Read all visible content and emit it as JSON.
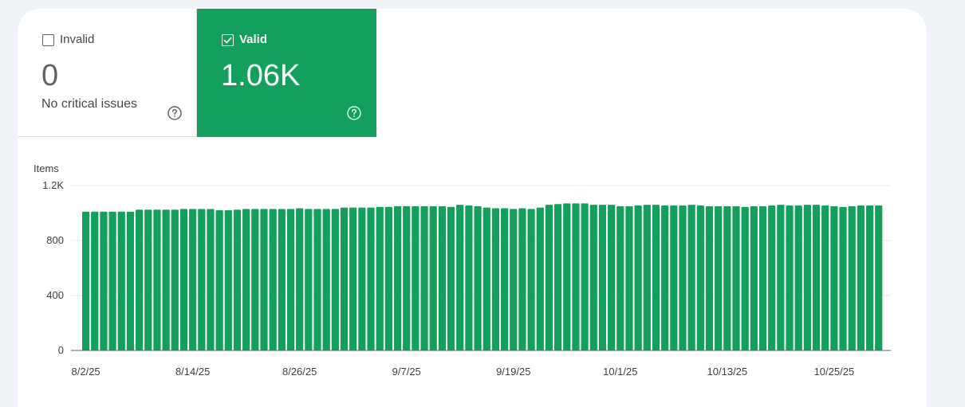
{
  "tabs": {
    "invalid": {
      "label": "Invalid",
      "value": "0",
      "subtitle": "No critical issues",
      "checked": false
    },
    "valid": {
      "label": "Valid",
      "value": "1.06K",
      "checked": true
    }
  },
  "colors": {
    "valid_green": "#12a05c",
    "bar_green": "#12a05c",
    "grid": "#e8eaed",
    "text": "#3c4043"
  },
  "icons": {
    "help": "help-circle-icon",
    "checkbox": "checkbox-icon"
  },
  "chart_data": {
    "type": "bar",
    "ylabel": "Items",
    "ylim": [
      0,
      1200
    ],
    "yticks": [
      {
        "value": 0,
        "label": "0"
      },
      {
        "value": 400,
        "label": "400"
      },
      {
        "value": 800,
        "label": "800"
      },
      {
        "value": 1200,
        "label": "1.2K"
      }
    ],
    "x_tick_labels": [
      {
        "index": 0,
        "label": "8/2/25"
      },
      {
        "index": 12,
        "label": "8/14/25"
      },
      {
        "index": 24,
        "label": "8/26/25"
      },
      {
        "index": 36,
        "label": "9/7/25"
      },
      {
        "index": 48,
        "label": "9/19/25"
      },
      {
        "index": 60,
        "label": "10/1/25"
      },
      {
        "index": 72,
        "label": "10/13/25"
      },
      {
        "index": 84,
        "label": "10/25/25"
      }
    ],
    "grid": true,
    "series": [
      {
        "values": [
          1010,
          1010,
          1010,
          1010,
          1010,
          1010,
          1025,
          1025,
          1025,
          1025,
          1025,
          1030,
          1030,
          1030,
          1030,
          1020,
          1020,
          1025,
          1030,
          1030,
          1030,
          1030,
          1030,
          1030,
          1035,
          1030,
          1030,
          1030,
          1030,
          1040,
          1040,
          1040,
          1040,
          1045,
          1045,
          1050,
          1050,
          1050,
          1050,
          1050,
          1050,
          1045,
          1060,
          1055,
          1050,
          1040,
          1035,
          1035,
          1030,
          1035,
          1030,
          1040,
          1060,
          1065,
          1070,
          1070,
          1070,
          1060,
          1060,
          1060,
          1050,
          1050,
          1055,
          1060,
          1060,
          1055,
          1055,
          1055,
          1060,
          1055,
          1050,
          1050,
          1050,
          1050,
          1045,
          1050,
          1050,
          1055,
          1060,
          1055,
          1055,
          1060,
          1060,
          1055,
          1050,
          1045,
          1050,
          1055,
          1055,
          1055
        ]
      }
    ]
  }
}
